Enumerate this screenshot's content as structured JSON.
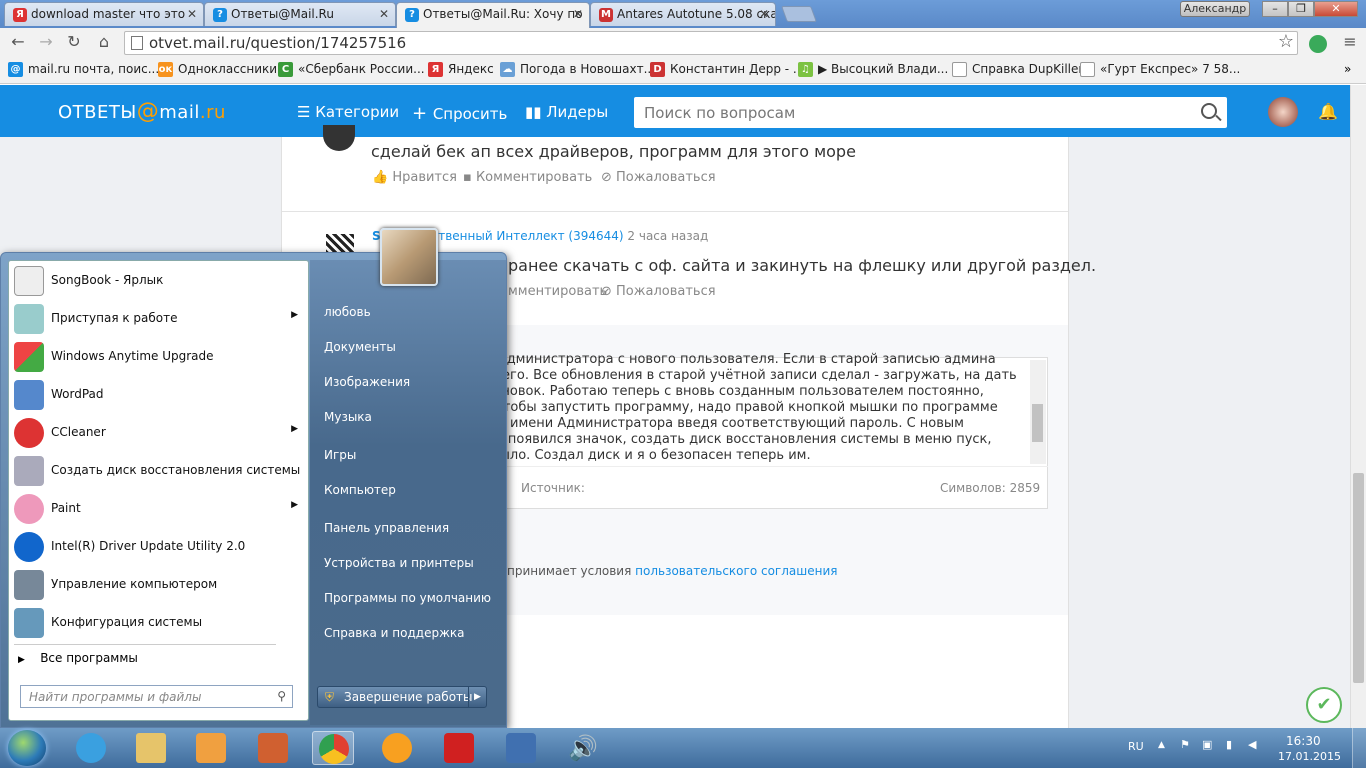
{
  "browser": {
    "tabs": [
      {
        "label": "download master что это",
        "fav": "Я",
        "color": "#d33"
      },
      {
        "label": "Ответы@Mail.Ru",
        "fav": "?",
        "color": "#168de2"
      },
      {
        "label": "Ответы@Mail.Ru: Хочу по",
        "fav": "?",
        "color": "#168de2"
      },
      {
        "label": "Antares Autotune 5.08 ска",
        "fav": "M",
        "color": "#c33"
      }
    ],
    "user_badge": "Александр",
    "url": "otvet.mail.ru/question/174257516",
    "bookmarks": [
      {
        "label": "mail.ru почта, поис...",
        "fav": "@",
        "color": "#168de2"
      },
      {
        "label": "Одноклассники",
        "fav": "ок",
        "color": "#f7931e"
      },
      {
        "label": "«Сбербанк России...",
        "fav": "С",
        "color": "#3a9b3a"
      },
      {
        "label": "Яндекс",
        "fav": "Я",
        "color": "#d33"
      },
      {
        "label": "Погода в Новошахт...",
        "fav": "☁",
        "color": "#6aa0d6"
      },
      {
        "label": "Константин Дерр - ...",
        "fav": "D",
        "color": "#c33"
      },
      {
        "label": "▶ Высоцкий Влади...",
        "fav": "♫",
        "color": "#7cc242"
      },
      {
        "label": "Справка DupKiller",
        "fav": "",
        "color": "#fff"
      },
      {
        "label": "«Гурт Експрес» 7 58...",
        "fav": "",
        "color": "#fff"
      }
    ]
  },
  "site": {
    "logo_text": "ОТВЕТЫ",
    "logo_at": "@",
    "logo_domain": "mail",
    "logo_tld": ".ru",
    "nav": {
      "categories": "Категории",
      "ask": "Спросить",
      "leaders": "Лидеры"
    },
    "search_placeholder": "Поиск по вопросам",
    "answer1": {
      "text": "сделай бек ап всех драйверов, программ для этого море",
      "like": "Нравится",
      "comment": "Комментировать",
      "report": "Пожаловаться"
    },
    "answer2": {
      "author": "S",
      "meta": "кусственный Интеллект (394644)",
      "time": "2 часа назад",
      "text": "ранее скачать с оф. сайта и закинуть на флешку или другой раздел.",
      "comment": "мментировать",
      "report": "Пожаловаться"
    },
    "editor_lines": [
      "ава администратора с нового пользователя. Если в старой записью админа",
      "влю его. Все обновления в старой учётной записи сделал - загружать, на дать",
      "установок.  Работаю теперь с вновь созданным пользователем постоянно,",
      "рь,  чтобы запустить программу, надо правой кнопкой мышки по программе",
      "ть от имени Администратора введя соответствующий пароль. С новым",
      "ения появился значок, создать диск восстановления системы в меню пуск,",
      " не было.  Создал диск и я о безопасен теперь им."
    ],
    "editor_source_label": "Источник:",
    "editor_char_count": "Символов: 2859",
    "terms_prefix": "принимает условия",
    "terms_link": "пользовательского соглашения"
  },
  "start_menu": {
    "programs": [
      {
        "label": "SongBook - Ярлык",
        "submenu": false,
        "icon": "songbook-icon",
        "color": "#eee"
      },
      {
        "label": "Приступая к работе",
        "submenu": true,
        "icon": "getting-started-icon",
        "color": "#9cc"
      },
      {
        "label": "Windows Anytime Upgrade",
        "submenu": false,
        "icon": "windows-flag-icon",
        "color": "#4a9"
      },
      {
        "label": "WordPad",
        "submenu": false,
        "icon": "wordpad-icon",
        "color": "#58c"
      },
      {
        "label": "CCleaner",
        "submenu": true,
        "icon": "ccleaner-icon",
        "color": "#d33"
      },
      {
        "label": "Создать диск восстановления системы",
        "submenu": false,
        "icon": "recovery-disc-icon",
        "color": "#aab"
      },
      {
        "label": "Paint",
        "submenu": true,
        "icon": "paint-icon",
        "color": "#e9b"
      },
      {
        "label": "Intel(R) Driver Update Utility 2.0",
        "submenu": false,
        "icon": "intel-icon",
        "color": "#16c"
      },
      {
        "label": "Управление компьютером",
        "submenu": false,
        "icon": "computer-management-icon",
        "color": "#789"
      },
      {
        "label": "Конфигурация системы",
        "submenu": false,
        "icon": "msconfig-icon",
        "color": "#69b"
      }
    ],
    "all_programs": "Все программы",
    "search_placeholder": "Найти программы и файлы",
    "right_links": [
      "любовь",
      "Документы",
      "Изображения",
      "Музыка",
      "Игры",
      "Компьютер",
      "Панель управления",
      "Устройства и принтеры",
      "Программы по умолчанию",
      "Справка и поддержка"
    ],
    "shutdown": "Завершение работы"
  },
  "taskbar": {
    "apps": [
      {
        "name": "internet-explorer-icon",
        "color": "#3aa0e0"
      },
      {
        "name": "explorer-folder-icon",
        "color": "#e6c46a"
      },
      {
        "name": "media-player-icon",
        "color": "#f0a040"
      },
      {
        "name": "toolbox-icon",
        "color": "#d06030"
      },
      {
        "name": "chrome-icon",
        "color": "#e04030"
      },
      {
        "name": "orange-app-icon",
        "color": "#f8a020"
      },
      {
        "name": "dk-app-icon",
        "color": "#d02020"
      },
      {
        "name": "virtualbox-icon",
        "color": "#4070b0"
      },
      {
        "name": "volume-app-icon",
        "color": "#c05040"
      }
    ],
    "lang": "RU",
    "time": "16:30",
    "date": "17.01.2015"
  }
}
